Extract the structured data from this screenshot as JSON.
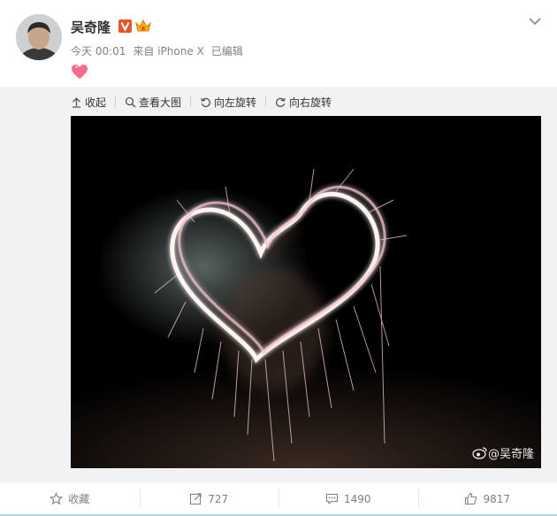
{
  "post": {
    "author": "吴奇隆",
    "time": "今天 00:01",
    "source": "来自 iPhone X",
    "edited": "已编辑"
  },
  "toolbar": {
    "collapse": "收起",
    "view_large": "查看大图",
    "rotate_left": "向左旋转",
    "rotate_right": "向右旋转"
  },
  "photo": {
    "watermark": "@吴奇隆"
  },
  "actions": {
    "favorite": "收藏",
    "repost": "727",
    "comment": "1490",
    "like": "9817"
  },
  "colors": {
    "accent": "#e8532a",
    "muted": "#808080",
    "panel": "#f2f2f5"
  },
  "icons": [
    "chevron-down-icon",
    "verified-v-icon",
    "crown-icon",
    "heart-emoji-icon",
    "arrow-up-icon",
    "magnifier-icon",
    "rotate-left-icon",
    "rotate-right-icon",
    "weibo-logo-icon",
    "star-icon",
    "repost-icon",
    "comment-icon",
    "thumbs-up-icon"
  ]
}
